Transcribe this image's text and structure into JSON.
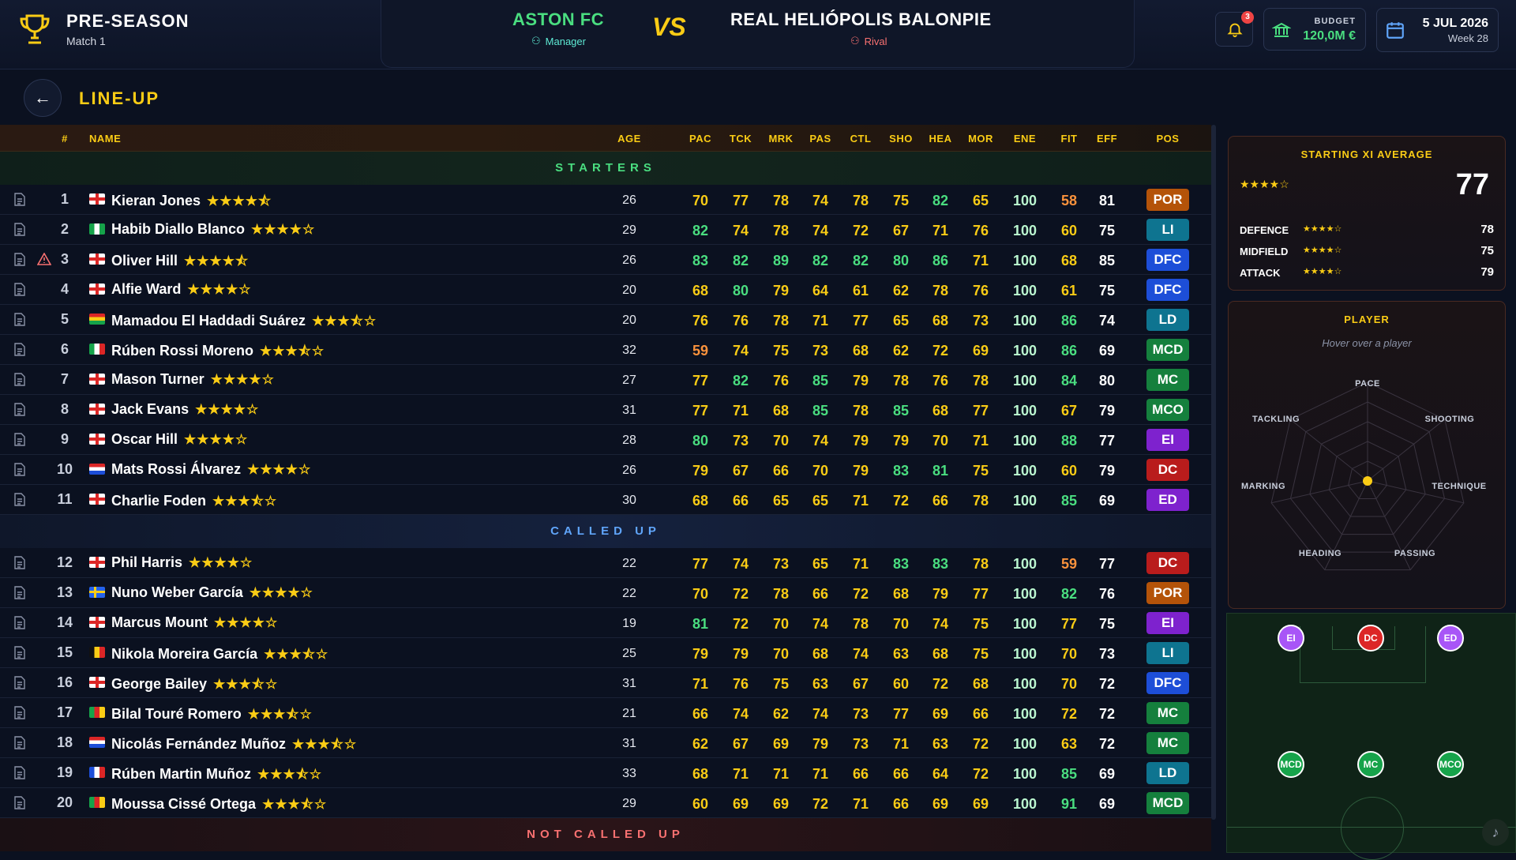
{
  "header": {
    "season": "PRE-SEASON",
    "match": "Match 1",
    "home_team": "ASTON FC",
    "home_role": "Manager",
    "vs": "VS",
    "away_team": "REAL HELIÓPOLIS BALONPIE",
    "away_role": "Rival",
    "notifications": "3",
    "budget_label": "BUDGET",
    "budget_value": "120,0M €",
    "date": "5 JUL 2026",
    "week": "Week 28"
  },
  "page": {
    "title": "LINE-UP"
  },
  "table": {
    "columns": [
      "#",
      "NAME",
      "AGE",
      "PAC",
      "TCK",
      "MRK",
      "PAS",
      "CTL",
      "SHO",
      "HEA",
      "MOR",
      "ENE",
      "FIT",
      "EFF",
      "POS"
    ],
    "sections": {
      "starters": "STARTERS",
      "called_up": "CALLED UP",
      "not_called_up": "NOT CALLED UP"
    },
    "starters": [
      {
        "n": "1",
        "name": "Kieran Jones",
        "stars": "★★★★⯪",
        "flag": "eng",
        "age": "26",
        "stats": [
          "70",
          "77",
          "78",
          "74",
          "78",
          "75",
          "82",
          "65",
          "100",
          "58",
          "81"
        ],
        "pos": "POR"
      },
      {
        "n": "2",
        "name": "Habib Diallo Blanco",
        "stars": "★★★★☆",
        "flag": "nga",
        "age": "29",
        "stats": [
          "82",
          "74",
          "78",
          "74",
          "72",
          "67",
          "71",
          "76",
          "100",
          "60",
          "75"
        ],
        "pos": "LI"
      },
      {
        "n": "3",
        "name": "Oliver Hill",
        "stars": "★★★★⯪",
        "flag": "eng",
        "age": "26",
        "stats": [
          "83",
          "82",
          "89",
          "82",
          "82",
          "80",
          "86",
          "71",
          "100",
          "68",
          "85"
        ],
        "pos": "DFC"
      },
      {
        "n": "4",
        "name": "Alfie Ward",
        "stars": "★★★★☆",
        "flag": "eng",
        "age": "20",
        "stats": [
          "68",
          "80",
          "79",
          "64",
          "61",
          "62",
          "78",
          "76",
          "100",
          "61",
          "75"
        ],
        "pos": "DFC"
      },
      {
        "n": "5",
        "name": "Mamadou El Haddadi Suárez",
        "stars": "★★★⯪☆",
        "flag": "gha",
        "age": "20",
        "stats": [
          "76",
          "76",
          "78",
          "71",
          "77",
          "65",
          "68",
          "73",
          "100",
          "86",
          "74"
        ],
        "pos": "LD"
      },
      {
        "n": "6",
        "name": "Rúben Rossi Moreno",
        "stars": "★★★⯪☆",
        "flag": "ita",
        "age": "32",
        "stats": [
          "59",
          "74",
          "75",
          "73",
          "68",
          "62",
          "72",
          "69",
          "100",
          "86",
          "69"
        ],
        "pos": "MCD"
      },
      {
        "n": "7",
        "name": "Mason Turner",
        "stars": "★★★★☆",
        "flag": "eng",
        "age": "27",
        "stats": [
          "77",
          "82",
          "76",
          "85",
          "79",
          "78",
          "76",
          "78",
          "100",
          "84",
          "80"
        ],
        "pos": "MC"
      },
      {
        "n": "8",
        "name": "Jack Evans",
        "stars": "★★★★☆",
        "flag": "eng",
        "age": "31",
        "stats": [
          "77",
          "71",
          "68",
          "85",
          "78",
          "85",
          "68",
          "77",
          "100",
          "67",
          "79"
        ],
        "pos": "MCO"
      },
      {
        "n": "9",
        "name": "Oscar Hill",
        "stars": "★★★★☆",
        "flag": "eng",
        "age": "28",
        "stats": [
          "80",
          "73",
          "70",
          "74",
          "79",
          "79",
          "70",
          "71",
          "100",
          "88",
          "77"
        ],
        "pos": "EI"
      },
      {
        "n": "10",
        "name": "Mats Rossi Álvarez",
        "stars": "★★★★☆",
        "flag": "ned",
        "age": "26",
        "stats": [
          "79",
          "67",
          "66",
          "70",
          "79",
          "83",
          "81",
          "75",
          "100",
          "60",
          "79"
        ],
        "pos": "DC"
      },
      {
        "n": "11",
        "name": "Charlie Foden",
        "stars": "★★★⯪☆",
        "flag": "eng",
        "age": "30",
        "stats": [
          "68",
          "66",
          "65",
          "65",
          "71",
          "72",
          "66",
          "78",
          "100",
          "85",
          "69"
        ],
        "pos": "ED"
      }
    ],
    "called_up": [
      {
        "n": "12",
        "name": "Phil Harris",
        "stars": "★★★★☆",
        "flag": "eng",
        "age": "22",
        "stats": [
          "77",
          "74",
          "73",
          "65",
          "71",
          "83",
          "83",
          "78",
          "100",
          "59",
          "77"
        ],
        "pos": "DC"
      },
      {
        "n": "13",
        "name": "Nuno Weber García",
        "stars": "★★★★☆",
        "flag": "swe",
        "age": "22",
        "stats": [
          "70",
          "72",
          "78",
          "66",
          "72",
          "68",
          "79",
          "77",
          "100",
          "82",
          "76"
        ],
        "pos": "POR"
      },
      {
        "n": "14",
        "name": "Marcus Mount",
        "stars": "★★★★☆",
        "flag": "eng",
        "age": "19",
        "stats": [
          "81",
          "72",
          "70",
          "74",
          "78",
          "70",
          "74",
          "75",
          "100",
          "77",
          "75"
        ],
        "pos": "EI"
      },
      {
        "n": "15",
        "name": "Nikola Moreira García",
        "stars": "★★★⯪☆",
        "flag": "bel",
        "age": "25",
        "stats": [
          "79",
          "79",
          "70",
          "68",
          "74",
          "63",
          "68",
          "75",
          "100",
          "70",
          "73"
        ],
        "pos": "LI"
      },
      {
        "n": "16",
        "name": "George Bailey",
        "stars": "★★★⯪☆",
        "flag": "eng",
        "age": "31",
        "stats": [
          "71",
          "76",
          "75",
          "63",
          "67",
          "60",
          "72",
          "68",
          "100",
          "70",
          "72"
        ],
        "pos": "DFC"
      },
      {
        "n": "17",
        "name": "Bilal Touré Romero",
        "stars": "★★★⯪☆",
        "flag": "cmr",
        "age": "21",
        "stats": [
          "66",
          "74",
          "62",
          "74",
          "73",
          "77",
          "69",
          "66",
          "100",
          "72",
          "72"
        ],
        "pos": "MC"
      },
      {
        "n": "18",
        "name": "Nicolás Fernández Muñoz",
        "stars": "★★★⯪☆",
        "flag": "ned",
        "age": "31",
        "stats": [
          "62",
          "67",
          "69",
          "79",
          "73",
          "71",
          "63",
          "72",
          "100",
          "63",
          "72"
        ],
        "pos": "MC"
      },
      {
        "n": "19",
        "name": "Rúben Martin Muñoz",
        "stars": "★★★⯪☆",
        "flag": "fra",
        "age": "33",
        "stats": [
          "68",
          "71",
          "71",
          "71",
          "66",
          "66",
          "64",
          "72",
          "100",
          "85",
          "69"
        ],
        "pos": "LD"
      },
      {
        "n": "20",
        "name": "Moussa Cissé Ortega",
        "stars": "★★★⯪☆",
        "flag": "cmr",
        "age": "29",
        "stats": [
          "60",
          "69",
          "69",
          "72",
          "71",
          "66",
          "69",
          "69",
          "100",
          "91",
          "69"
        ],
        "pos": "MCD"
      }
    ]
  },
  "averages": {
    "title": "STARTING XI AVERAGE",
    "stars": "★★★★☆",
    "overall": "77",
    "lines": [
      {
        "label": "DEFENCE",
        "stars": "★★★★☆",
        "value": "78"
      },
      {
        "label": "MIDFIELD",
        "stars": "★★★★☆",
        "value": "75"
      },
      {
        "label": "ATTACK",
        "stars": "★★★★☆",
        "value": "79"
      }
    ]
  },
  "player_panel": {
    "title": "PLAYER",
    "hint": "Hover over a player",
    "axes": [
      "PACE",
      "SHOOTING",
      "TECHNIQUE",
      "PASSING",
      "HEADING",
      "MARKING",
      "TACKLING"
    ]
  },
  "pitch": {
    "chips": [
      "EI",
      "DC",
      "ED",
      "MCD",
      "MC",
      "MCO"
    ]
  },
  "colors": {
    "accent": "#facc15",
    "green": "#4ade80",
    "header_bg": "#0d1426"
  }
}
